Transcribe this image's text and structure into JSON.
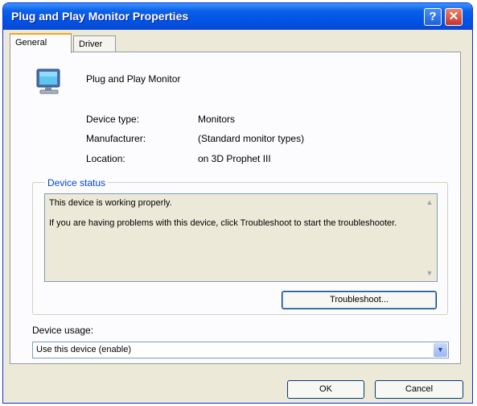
{
  "window": {
    "title": "Plug and Play Monitor Properties"
  },
  "titlebar": {
    "help_glyph": "?",
    "close_glyph": "✕"
  },
  "tabs": [
    {
      "label": "General",
      "selected": true
    },
    {
      "label": "Driver",
      "selected": false
    }
  ],
  "device": {
    "name": "Plug and Play Monitor",
    "icon": "monitor-icon",
    "properties": [
      {
        "label": "Device type:",
        "value": "Monitors"
      },
      {
        "label": "Manufacturer:",
        "value": "(Standard monitor types)"
      },
      {
        "label": "Location:",
        "value": "on 3D Prophet III"
      }
    ]
  },
  "status": {
    "legend": "Device status",
    "line1": "This device is working properly.",
    "line2": "If you are having problems with this device, click Troubleshoot to start the troubleshooter."
  },
  "buttons": {
    "troubleshoot": "Troubleshoot...",
    "ok": "OK",
    "cancel": "Cancel"
  },
  "usage": {
    "label": "Device usage:",
    "selected": "Use this device (enable)"
  },
  "colors": {
    "title_bar": "#0052e4",
    "dialog": "#ece9d8",
    "legend": "#0046d5"
  }
}
